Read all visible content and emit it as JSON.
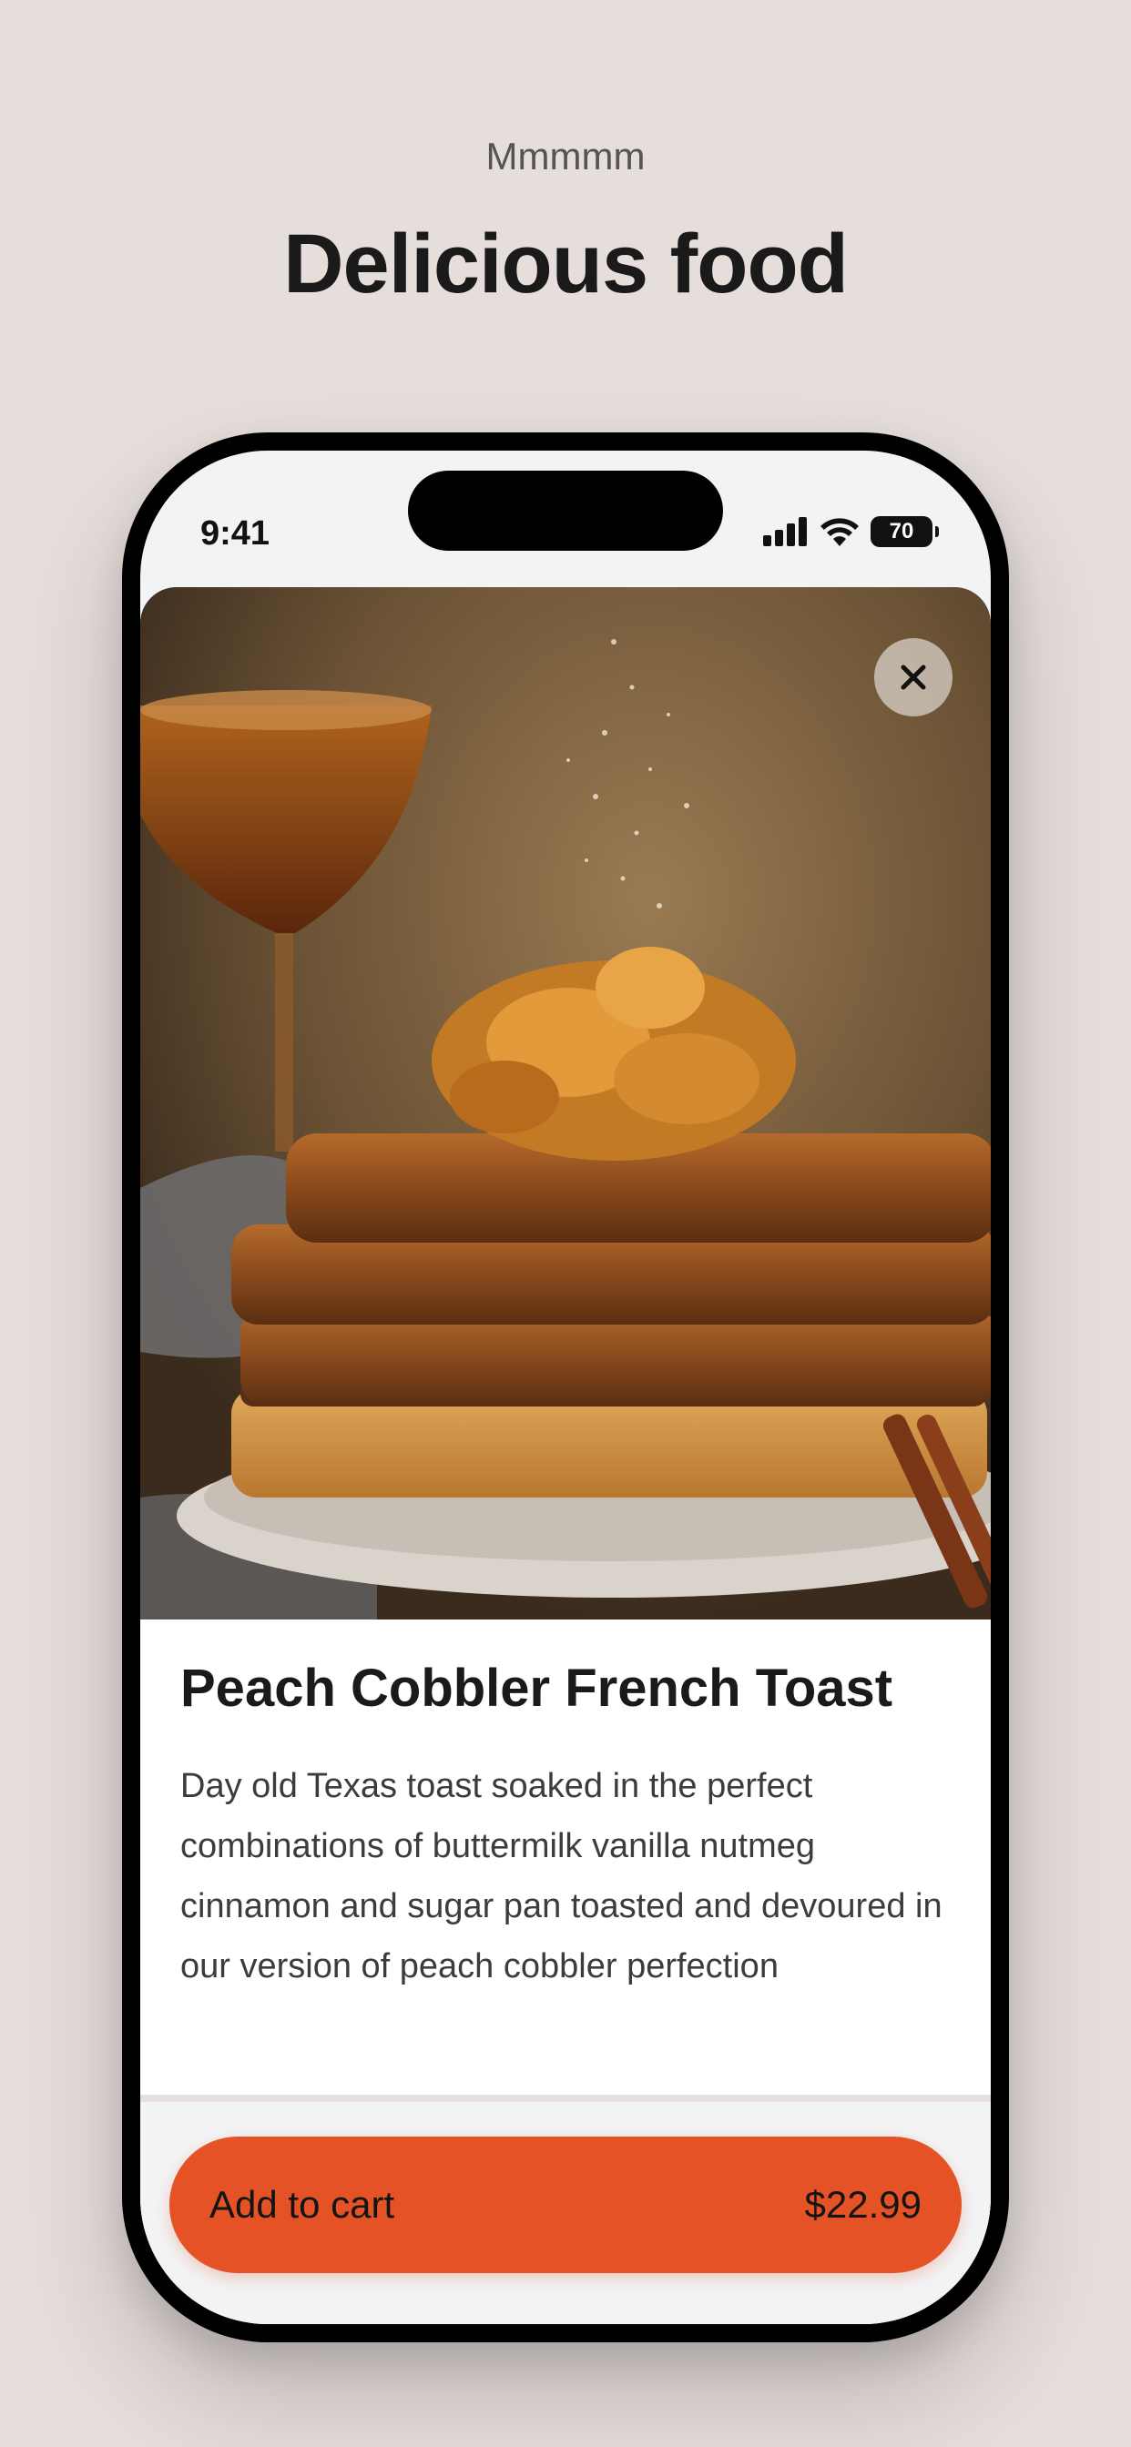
{
  "header": {
    "eyebrow": "Mmmmm",
    "title": "Delicious food"
  },
  "status_bar": {
    "time": "9:41",
    "battery": "70",
    "icons": [
      "cellular-signal-icon",
      "wifi-icon",
      "battery-icon"
    ]
  },
  "product": {
    "image_icon": "french-toast-photo",
    "close_icon": "close-icon",
    "name": "Peach Cobbler French Toast",
    "description": "Day old Texas toast soaked in the perfect combinations of buttermilk vanilla nutmeg cinnamon and sugar pan toasted and devoured in our version of peach cobbler perfection"
  },
  "cart": {
    "label": "Add to cart",
    "price": "$22.99"
  },
  "colors": {
    "background": "#e6dedb",
    "accent": "#e55225",
    "text": "#1c1c1c"
  }
}
